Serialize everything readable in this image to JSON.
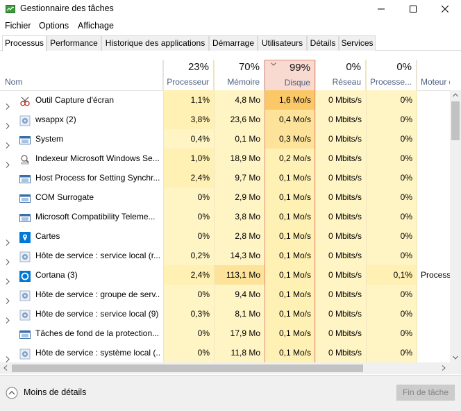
{
  "window": {
    "title": "Gestionnaire des tâches"
  },
  "menu": [
    "Fichier",
    "Options",
    "Affichage"
  ],
  "tabs": [
    "Processus",
    "Performance",
    "Historique des applications",
    "Démarrage",
    "Utilisateurs",
    "Détails",
    "Services"
  ],
  "active_tab": "Processus",
  "columns": [
    {
      "key": "name",
      "label": "Nom",
      "pct": ""
    },
    {
      "key": "cpu",
      "label": "Processeur",
      "pct": "23%"
    },
    {
      "key": "mem",
      "label": "Mémoire",
      "pct": "70%"
    },
    {
      "key": "disk",
      "label": "Disque",
      "pct": "99%",
      "sorted": true
    },
    {
      "key": "net",
      "label": "Réseau",
      "pct": "0%"
    },
    {
      "key": "gpu",
      "label": "Processe...",
      "pct": "0%"
    },
    {
      "key": "engine",
      "label": "Moteur de",
      "pct": ""
    }
  ],
  "rows": [
    {
      "name": "Outil Capture d'écran",
      "icon": "snipping-tool-icon",
      "expandable": true,
      "cpu": "1,1%",
      "mem": "4,8 Mo",
      "disk": "1,6 Mo/s",
      "net": "0 Mbits/s",
      "gpu": "0%",
      "engine": ""
    },
    {
      "name": "wsappx (2)",
      "icon": "gear-icon",
      "expandable": true,
      "cpu": "3,8%",
      "mem": "23,6 Mo",
      "disk": "0,4 Mo/s",
      "net": "0 Mbits/s",
      "gpu": "0%",
      "engine": ""
    },
    {
      "name": "System",
      "icon": "system-window-icon",
      "expandable": true,
      "cpu": "0,4%",
      "mem": "0,1 Mo",
      "disk": "0,3 Mo/s",
      "net": "0 Mbits/s",
      "gpu": "0%",
      "engine": ""
    },
    {
      "name": "Indexeur Microsoft Windows Se...",
      "icon": "search-indexer-icon",
      "expandable": true,
      "cpu": "1,0%",
      "mem": "18,9 Mo",
      "disk": "0,2 Mo/s",
      "net": "0 Mbits/s",
      "gpu": "0%",
      "engine": ""
    },
    {
      "name": "Host Process for Setting Synchr...",
      "icon": "system-window-icon",
      "expandable": false,
      "cpu": "2,4%",
      "mem": "9,7 Mo",
      "disk": "0,1 Mo/s",
      "net": "0 Mbits/s",
      "gpu": "0%",
      "engine": ""
    },
    {
      "name": "COM Surrogate",
      "icon": "system-window-icon",
      "expandable": false,
      "cpu": "0%",
      "mem": "2,9 Mo",
      "disk": "0,1 Mo/s",
      "net": "0 Mbits/s",
      "gpu": "0%",
      "engine": ""
    },
    {
      "name": "Microsoft Compatibility Teleme...",
      "icon": "system-window-icon",
      "expandable": false,
      "cpu": "0%",
      "mem": "3,8 Mo",
      "disk": "0,1 Mo/s",
      "net": "0 Mbits/s",
      "gpu": "0%",
      "engine": ""
    },
    {
      "name": "Cartes",
      "icon": "maps-icon",
      "expandable": true,
      "cpu": "0%",
      "mem": "2,8 Mo",
      "disk": "0,1 Mo/s",
      "net": "0 Mbits/s",
      "gpu": "0%",
      "engine": ""
    },
    {
      "name": "Hôte de service : service local (r...",
      "icon": "gear-icon",
      "expandable": true,
      "cpu": "0,2%",
      "mem": "14,3 Mo",
      "disk": "0,1 Mo/s",
      "net": "0 Mbits/s",
      "gpu": "0%",
      "engine": ""
    },
    {
      "name": "Cortana (3)",
      "icon": "cortana-icon",
      "expandable": true,
      "cpu": "2,4%",
      "mem": "113,1 Mo",
      "disk": "0,1 Mo/s",
      "net": "0 Mbits/s",
      "gpu": "0,1%",
      "engine": "Process"
    },
    {
      "name": "Hôte de service : groupe de serv...",
      "icon": "gear-icon",
      "expandable": true,
      "cpu": "0%",
      "mem": "9,4 Mo",
      "disk": "0,1 Mo/s",
      "net": "0 Mbits/s",
      "gpu": "0%",
      "engine": ""
    },
    {
      "name": "Hôte de service : service local (9)",
      "icon": "gear-icon",
      "expandable": true,
      "cpu": "0,3%",
      "mem": "8,1 Mo",
      "disk": "0,1 Mo/s",
      "net": "0 Mbits/s",
      "gpu": "0%",
      "engine": ""
    },
    {
      "name": "Tâches de fond de la protection...",
      "icon": "system-window-icon",
      "expandable": false,
      "cpu": "0%",
      "mem": "17,9 Mo",
      "disk": "0,1 Mo/s",
      "net": "0 Mbits/s",
      "gpu": "0%",
      "engine": ""
    },
    {
      "name": "Hôte de service : système local (...",
      "icon": "gear-icon",
      "expandable": true,
      "cpu": "0%",
      "mem": "11,8 Mo",
      "disk": "0,1 Mo/s",
      "net": "0 Mbits/s",
      "gpu": "0%",
      "engine": ""
    }
  ],
  "footer": {
    "less_details": "Moins de détails",
    "end_task": "Fin de tâche"
  },
  "colors": {
    "heat_light": "#fff4c4",
    "heat_mid": "#fff0b3",
    "heat_strong": "#fde39a",
    "heat_hot": "#fbc868",
    "sorted_header": "#f9dad0",
    "sorted_border": "#e38a70",
    "header_label": "#4d6082"
  }
}
